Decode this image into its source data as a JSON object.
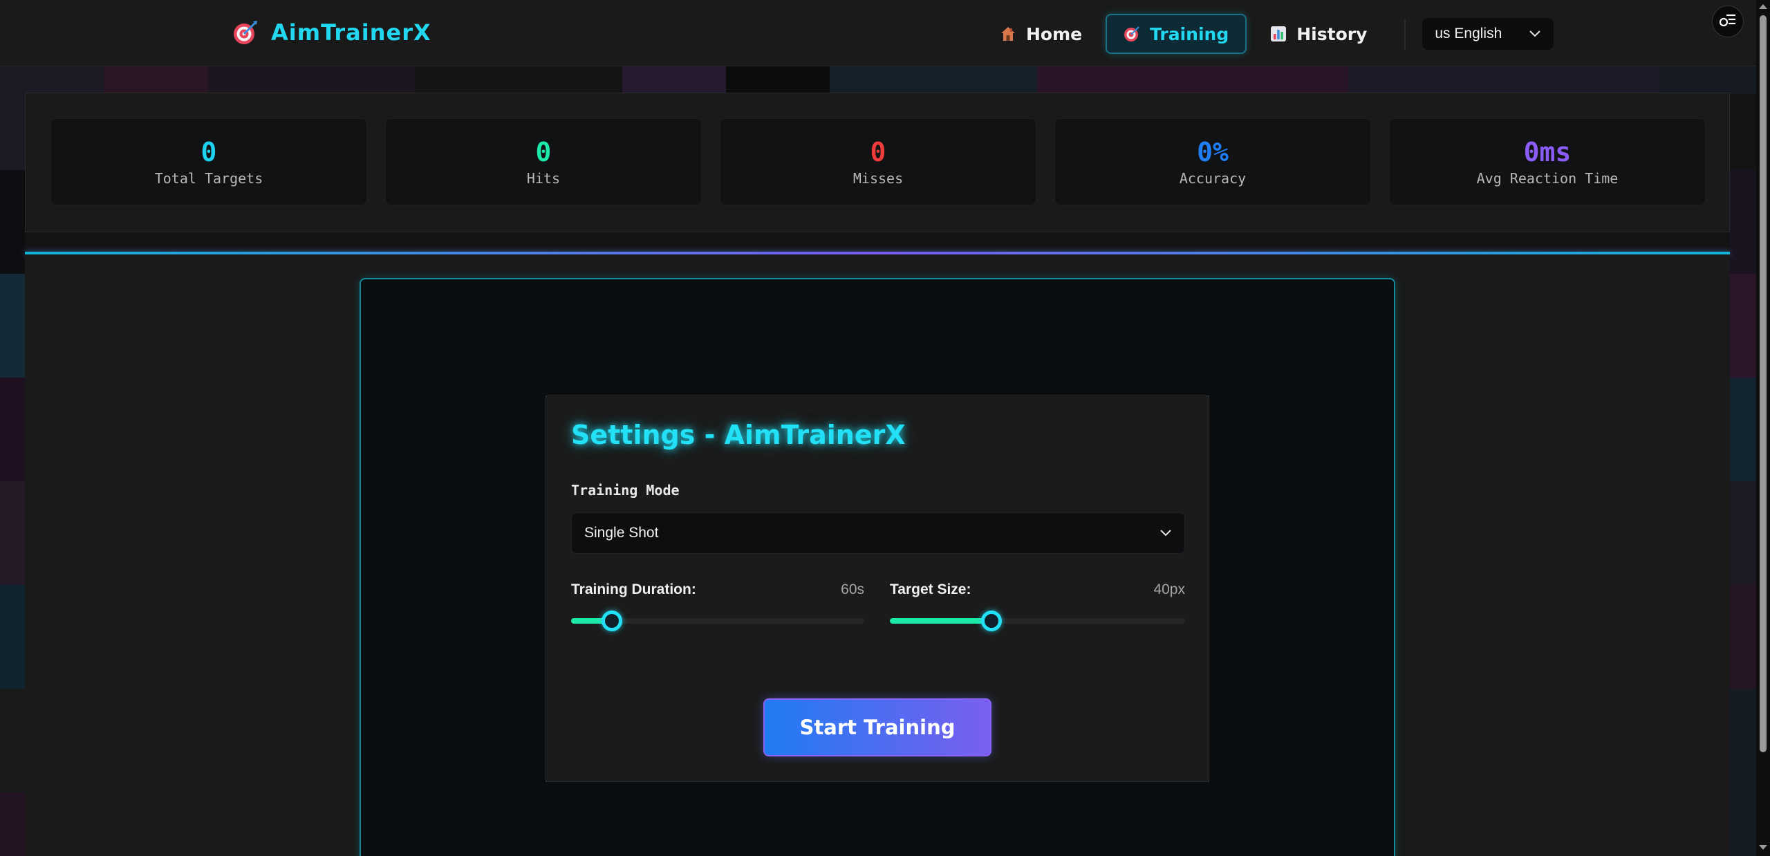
{
  "app": {
    "title": "AimTrainerX"
  },
  "nav": {
    "items": [
      {
        "label": "Home",
        "icon": "house-icon"
      },
      {
        "label": "Training",
        "icon": "target-icon",
        "active": true
      },
      {
        "label": "History",
        "icon": "bar-chart-icon"
      }
    ],
    "language": {
      "selected": "us English"
    }
  },
  "stats": [
    {
      "value": "0",
      "label": "Total Targets",
      "color": "#1fd3f0"
    },
    {
      "value": "0",
      "label": "Hits",
      "color": "#1de9a8"
    },
    {
      "value": "0",
      "label": "Misses",
      "color": "#ef3b3b"
    },
    {
      "value": "0%",
      "label": "Accuracy",
      "color": "#1f7ef5"
    },
    {
      "value": "0ms",
      "label": "Avg Reaction Time",
      "color": "#8b5cf6"
    }
  ],
  "settings": {
    "title": "Settings - AimTrainerX",
    "training_mode_label": "Training Mode",
    "training_mode_value": "Single Shot",
    "duration_label": "Training Duration:",
    "duration_value": "60s",
    "duration_fraction": 0.14,
    "target_size_label": "Target Size:",
    "target_size_value": "40px",
    "target_size_fraction": 0.345,
    "start_button": "Start Training"
  },
  "colors": {
    "accent": "#22e0f5",
    "slider_fill": "#1de9a8",
    "button_start": "#1f7bf2",
    "button_end": "#7a5ff0"
  }
}
